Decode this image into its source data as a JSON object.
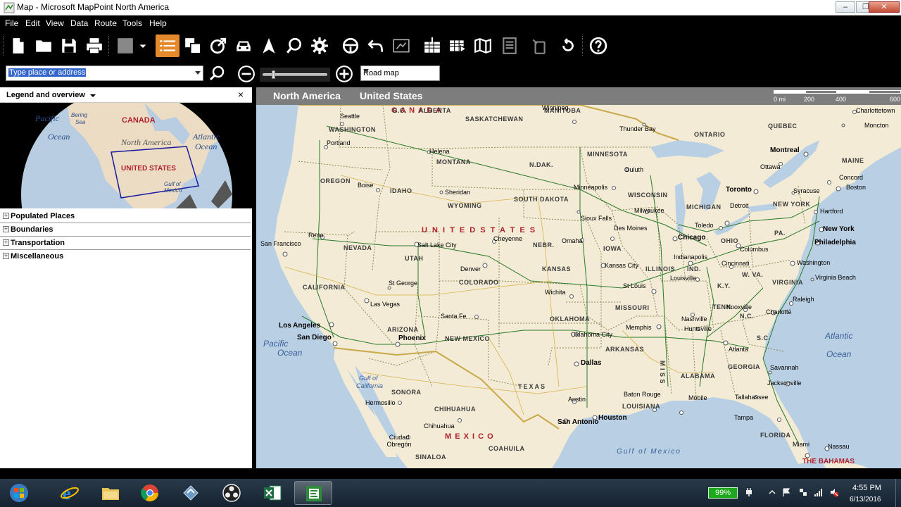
{
  "window": {
    "title": "Map - Microsoft MapPoint North America"
  },
  "menu": [
    "File",
    "Edit",
    "View",
    "Data",
    "Route",
    "Tools",
    "Help"
  ],
  "toolbar": {
    "icons": [
      "new-icon",
      "open-icon",
      "save-icon",
      "print-icon",
      "color-swatch-icon",
      "legend-list-icon",
      "copy-map-icon",
      "route-arrow-icon",
      "car-icon",
      "location-icon",
      "find-nearby-icon",
      "settings-icon",
      "steering-wheel-icon",
      "undo-icon",
      "export-icon",
      "import-data-icon",
      "data-wizard-icon",
      "map-icon",
      "report-icon",
      "gps-icon",
      "rotate-icon",
      "help-icon"
    ]
  },
  "search": {
    "placeholder": "Type place or address"
  },
  "map_style": {
    "selected": "Road map"
  },
  "legend": {
    "header": "Legend and overview",
    "close": "×",
    "overview_labels": {
      "pacific": "Pacific",
      "pacific2": "Ocean",
      "bering": "Bering",
      "bering2": "Sea",
      "canada": "CANADA",
      "north_america": "North America",
      "united_states": "UNITED STATES",
      "atlantic": "Atlantic",
      "atlantic2": "Ocean",
      "gulf": "Gulf of",
      "gulf2": "Mexico"
    },
    "categories": [
      "Populated Places",
      "Boundaries",
      "Transportation",
      "Miscellaneous"
    ]
  },
  "map": {
    "breadcrumb": [
      "North America",
      "United States"
    ],
    "scale": [
      "0 mi",
      "200",
      "400",
      "600"
    ],
    "countries": {
      "canada": "C A N A D A",
      "us": "U N I T E D   S T A T E S",
      "mexico": "M E X I C O",
      "bahamas": "THE BAHAMAS"
    },
    "oceans": {
      "pacific": "Pacific",
      "pacific2": "Ocean",
      "atlantic": "Atlantic",
      "atlantic2": "Ocean",
      "gulf_mexico": "Gulf of Mexico",
      "gulf_california": "Gulf of",
      "gulf_california2": "California"
    },
    "provinces": [
      "B.C.",
      "ALBERTA",
      "SASKATCHEWAN",
      "MANITOBA",
      "ONTARIO",
      "QUEBEC",
      "MAINE"
    ],
    "states": [
      "WASHINGTON",
      "OREGON",
      "IDAHO",
      "MONTANA",
      "WYOMING",
      "N.DAK.",
      "SOUTH DAKOTA",
      "MINNESOTA",
      "WISCONSIN",
      "MICHIGAN",
      "NEW YORK",
      "NEVADA",
      "UTAH",
      "COLORADO",
      "NEBR.",
      "IOWA",
      "ILLINOIS",
      "IND.",
      "OHIO",
      "PA.",
      "CALIFORNIA",
      "KANSAS",
      "MISSOURI",
      "K.Y.",
      "W. VA.",
      "VIRGINIA",
      "ARIZONA",
      "NEW MEXICO",
      "OKLAHOMA",
      "ARKANSAS",
      "TENN.",
      "N.C.",
      "S.C.",
      "TEXAS",
      "LOUISIANA",
      "M I S S",
      "ALABAMA",
      "GEORGIA",
      "FLORIDA",
      "SONORA",
      "CHIHUAHUA",
      "COAHUILA",
      "SINALOA"
    ],
    "cities": [
      "Seattle",
      "Portland",
      "Helena",
      "Boise",
      "Sheridan",
      "Winnipeg",
      "Thunder Bay",
      "Duluth",
      "Minneapolis",
      "Sioux Falls",
      "Milwaukee",
      "Toronto",
      "Ottawa",
      "Montreal",
      "Charlottetown",
      "Moncton",
      "Concord",
      "Boston",
      "Syracuse",
      "Hartford",
      "New York",
      "Philadelphia",
      "Washington",
      "Virginia Beach",
      "Reno",
      "San Francisco",
      "Salt Lake City",
      "Cheyenne",
      "Omaha",
      "Des Moines",
      "Chicago",
      "Toledo",
      "Detroit",
      "Columbus",
      "Indianapolis",
      "Cincinnati",
      "Louisville",
      "Denver",
      "Kansas City",
      "St Louis",
      "Wichita",
      "St George",
      "Las Vegas",
      "Los Angeles",
      "San Diego",
      "Phoenix",
      "Santa Fe",
      "Oklahoma City",
      "Memphis",
      "Nashville",
      "Huntsville",
      "Knoxville",
      "Charlotte",
      "Raleigh",
      "Atlanta",
      "Savannah",
      "Jacksonville",
      "Tallahassee",
      "Tampa",
      "Miami",
      "Nassau",
      "Dallas",
      "Austin",
      "San Antonio",
      "Houston",
      "Baton Rouge",
      "Mobile",
      "Hermosillo",
      "Chihuahua",
      "Ciudad Obregón"
    ]
  },
  "taskbar": {
    "apps": [
      "start-orb-icon",
      "internet-explorer-icon",
      "file-explorer-icon",
      "chrome-icon",
      "mappoint-icon",
      "obs-icon",
      "excel-icon",
      "project-icon"
    ],
    "battery": "99%",
    "time": "4:55 PM",
    "date": "6/13/2016"
  }
}
